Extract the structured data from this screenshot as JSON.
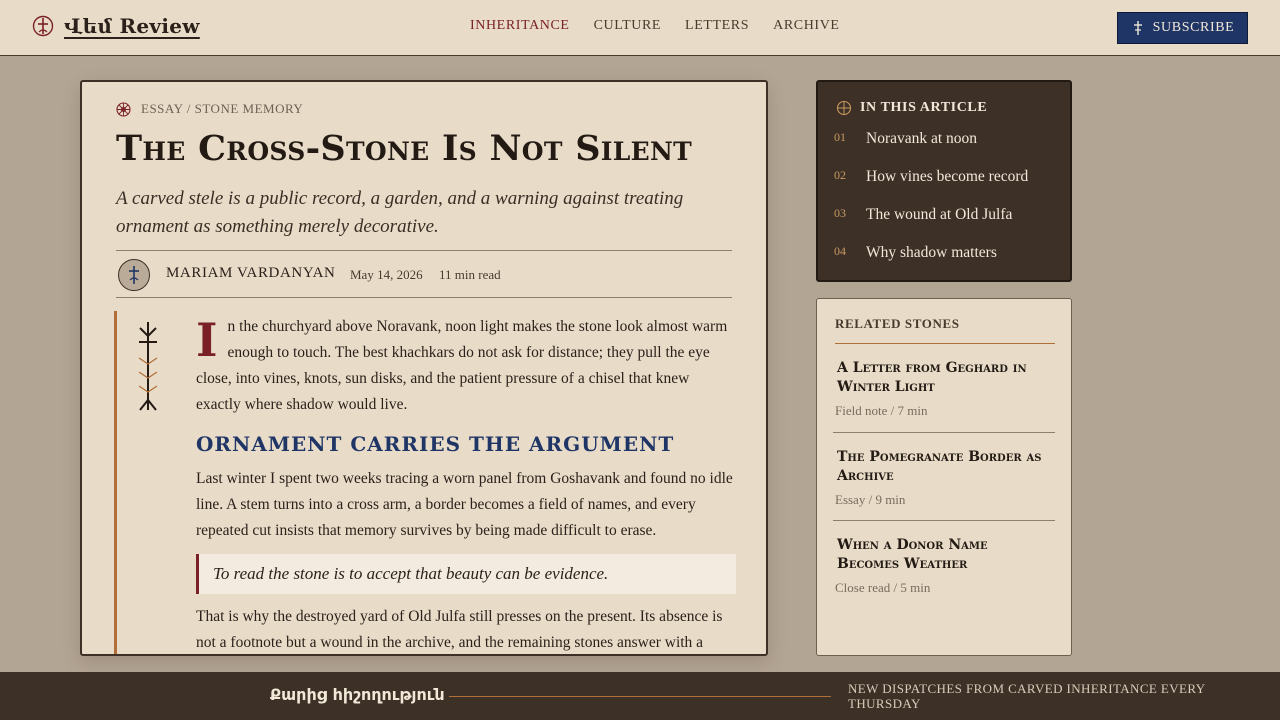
{
  "header": {
    "brand": "Վեմ Review",
    "nav": [
      {
        "label": "INHERITANCE",
        "active": true
      },
      {
        "label": "CULTURE",
        "active": false
      },
      {
        "label": "LETTERS",
        "active": false
      },
      {
        "label": "ARCHIVE",
        "active": false
      }
    ],
    "subscribe_label": "SUBSCRIBE"
  },
  "article": {
    "kicker": "ESSAY / STONE MEMORY",
    "title": "The Cross-Stone Is Not Silent",
    "dek": "A carved stele is a public record, a garden, and a warning against treating ornament as something merely decorative.",
    "author": "MARIAM VARDANYAN",
    "date": "May 14, 2026",
    "read_time": "11 min read",
    "drop_cap": "I",
    "paragraph_1": "n the churchyard above Noravank, noon light makes the stone look almost warm enough to touch. The best khachkars do not ask for distance; they pull the eye close, into vines, knots, sun disks, and the patient pressure of a chisel that knew exactly where shadow would live.",
    "subheading": "ORNAMENT CARRIES THE ARGUMENT",
    "paragraph_2": "Last winter I spent two weeks tracing a worn panel from Goshavank and found no idle line. A stem turns into a cross arm, a border becomes a field of names, and every repeated cut insists that memory survives by being made difficult to erase.",
    "pull_quote": "To read the stone is to accept that beauty can be evidence.",
    "paragraph_3": "That is why the destroyed yard of Old Julfa still presses on the present. Its absence is not a footnote but a wound in the archive, and the remaining stones answer with a grammar of persistence, vine, knot, and carved name."
  },
  "toc": {
    "heading": "IN THIS ARTICLE",
    "items": [
      {
        "num": "01",
        "label": "Noravank at noon"
      },
      {
        "num": "02",
        "label": "How vines become record"
      },
      {
        "num": "03",
        "label": "The wound at Old Julfa"
      },
      {
        "num": "04",
        "label": "Why shadow matters"
      }
    ]
  },
  "related": {
    "heading": "RELATED STONES",
    "items": [
      {
        "title": "A Letter from Geghard in Winter Light",
        "meta": "Field note / 7 min"
      },
      {
        "title": "The Pomegranate Border as Archive",
        "meta": "Essay / 9 min"
      },
      {
        "title": "When a Donor Name Becomes Weather",
        "meta": "Close read / 5 min"
      }
    ]
  },
  "footer": {
    "script_text": "Քարից հիշողություն",
    "note": "NEW DISPATCHES FROM CARVED INHERITANCE EVERY THURSDAY"
  },
  "colors": {
    "accent_red": "#7a2128",
    "accent_blue": "#1f3566",
    "accent_copper": "#b06f37",
    "paper": "#e8dcc9",
    "dark": "#3d3026"
  }
}
